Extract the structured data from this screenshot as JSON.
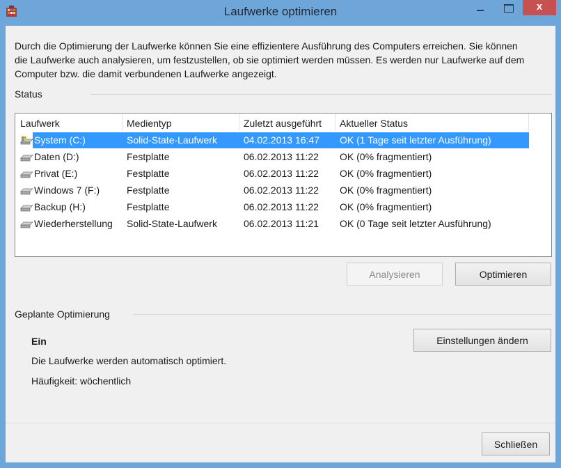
{
  "window": {
    "title": "Laufwerke optimieren",
    "app_icon": "defrag-app-icon",
    "close_glyph": "x"
  },
  "intro": {
    "text": "Durch die Optimierung der Laufwerke können Sie eine effizientere Ausführung des Computers erreichen. Sie können die Laufwerke auch analysieren, um festzustellen, ob sie optimiert werden müssen. Es werden nur Laufwerke auf dem Computer bzw. die damit verbundenen Laufwerke angezeigt."
  },
  "status": {
    "label": "Status",
    "columns": [
      "Laufwerk",
      "Medientyp",
      "Zuletzt ausgeführt",
      "Aktueller Status"
    ],
    "drives": [
      {
        "name": "System (C:)",
        "media": "Solid-State-Laufwerk",
        "last_run": "04.02.2013 16:47",
        "status": "OK (1 Tage seit letzter Ausführung)",
        "icon": "windows-drive-icon",
        "selected": true
      },
      {
        "name": "Daten (D:)",
        "media": "Festplatte",
        "last_run": "06.02.2013 11:22",
        "status": "OK (0% fragmentiert)",
        "icon": "drive-icon",
        "selected": false
      },
      {
        "name": "Privat (E:)",
        "media": "Festplatte",
        "last_run": "06.02.2013 11:22",
        "status": "OK (0% fragmentiert)",
        "icon": "drive-icon",
        "selected": false
      },
      {
        "name": "Windows 7 (F:)",
        "media": "Festplatte",
        "last_run": "06.02.2013 11:22",
        "status": "OK (0% fragmentiert)",
        "icon": "drive-icon",
        "selected": false
      },
      {
        "name": "Backup (H:)",
        "media": "Festplatte",
        "last_run": "06.02.2013 11:22",
        "status": "OK (0% fragmentiert)",
        "icon": "drive-icon",
        "selected": false
      },
      {
        "name": "Wiederherstellung",
        "media": "Solid-State-Laufwerk",
        "last_run": "06.02.2013 11:21",
        "status": "OK (0 Tage seit letzter Ausführung)",
        "icon": "drive-icon",
        "selected": false
      }
    ],
    "analyze_label": "Analysieren",
    "optimize_label": "Optimieren"
  },
  "scheduled": {
    "label": "Geplante Optimierung",
    "state": "Ein",
    "description": "Die Laufwerke werden automatisch optimiert.",
    "frequency": "Häufigkeit: wöchentlich",
    "change_settings_label": "Einstellungen ändern"
  },
  "footer": {
    "close_label": "Schließen"
  },
  "colors": {
    "titlebar": "#6fa6d9",
    "selection": "#3399ff",
    "close_button": "#c75050"
  }
}
